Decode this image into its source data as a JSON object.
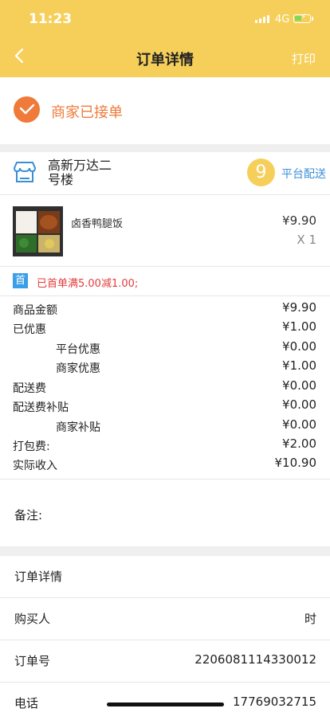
{
  "status_bar": {
    "time": "11:23",
    "network": "4G"
  },
  "header": {
    "title": "订单详情",
    "print_label": "打印"
  },
  "order_status": {
    "text": "商家已接单",
    "color": "#ef7a3a"
  },
  "store": {
    "name": "高新万达二号楼",
    "order_number": "9",
    "delivery_type": "平台配送"
  },
  "product": {
    "name": "卤香鸭腿饭",
    "price": "¥9.90",
    "quantity": "X 1"
  },
  "promo": {
    "badge": "首",
    "text": "已首单满5.00减1.00;"
  },
  "fees": [
    {
      "label": "商品金额",
      "value": "¥9.90",
      "indent": false
    },
    {
      "label": "已优惠",
      "value": "¥1.00",
      "indent": false
    },
    {
      "label": "平台优惠",
      "value": "¥0.00",
      "indent": true
    },
    {
      "label": "商家优惠",
      "value": "¥1.00",
      "indent": true
    },
    {
      "label": "配送费",
      "value": "¥0.00",
      "indent": false
    },
    {
      "label": "配送费补贴",
      "value": "¥0.00",
      "indent": false
    },
    {
      "label": "商家补贴",
      "value": "¥0.00",
      "indent": true
    },
    {
      "label": "打包费:",
      "value": "¥2.00",
      "indent": false
    },
    {
      "label": "实际收入",
      "value": "¥10.90",
      "indent": false
    }
  ],
  "remark_label": "备注:",
  "details": {
    "section_title": "订单详情",
    "buyer_label": "购买人",
    "buyer_value": "时",
    "order_no_label": "订单号",
    "order_no_value": "2206081114330012",
    "phone_label": "电话",
    "phone_value": "17769032715"
  },
  "colors": {
    "header_bg": "#f6cf5a",
    "accent_orange": "#ef7a3a",
    "accent_blue": "#3a8fd6",
    "promo_red": "#e23c3c"
  }
}
